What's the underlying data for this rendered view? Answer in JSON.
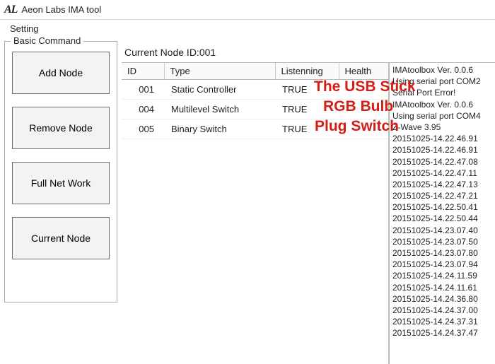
{
  "app": {
    "title": "Aeon Labs IMA tool",
    "logo_text": "AL"
  },
  "menu": {
    "setting": "Setting"
  },
  "sidebar": {
    "legend": "Basic Command",
    "buttons": {
      "add": "Add Node",
      "remove": "Remove Node",
      "fullnet": "Full Net Work",
      "current": "Current Node"
    }
  },
  "main": {
    "current_node_label": "Current Node ID:001",
    "columns": {
      "id": "ID",
      "type": "Type",
      "listening": "Listenning",
      "health": "Health"
    },
    "rows": [
      {
        "id": "001",
        "type": "Static Controller",
        "listening": "TRUE",
        "health": ""
      },
      {
        "id": "004",
        "type": "Multilevel Switch",
        "listening": "TRUE",
        "health": ""
      },
      {
        "id": "005",
        "type": "Binary Switch",
        "listening": "TRUE",
        "health": ""
      }
    ]
  },
  "log": [
    "IMAtoolbox Ver. 0.0.6",
    "Using serial port COM2",
    "Serial Port Error!",
    "IMAtoolbox Ver. 0.0.6",
    "Using serial port COM4",
    "Z-Wave 3.95",
    "20151025-14.22.46.91",
    "20151025-14.22.46.91",
    "20151025-14.22.47.08",
    "20151025-14.22.47.11",
    "20151025-14.22.47.13",
    "20151025-14.22.47.21",
    "20151025-14.22.50.41",
    "20151025-14.22.50.44",
    "20151025-14.23.07.40",
    "20151025-14.23.07.50",
    "20151025-14.23.07.80",
    "20151025-14.23.07.94",
    "20151025-14.24.11.59",
    "20151025-14.24.11.61",
    "20151025-14.24.36.80",
    "20151025-14.24.37.00",
    "20151025-14.24.37.31",
    "20151025-14.24.37.47"
  ],
  "annotations": {
    "a1": "The USB Stick",
    "a2": "RGB Bulb",
    "a3": "Plug Switch"
  }
}
